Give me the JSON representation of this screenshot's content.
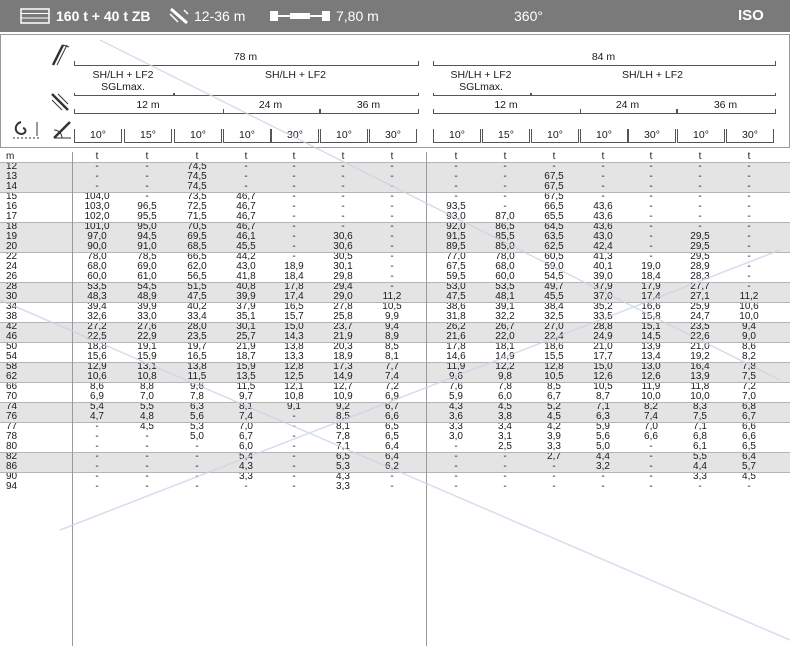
{
  "topbar": {
    "counterweight": "160 t + 40 t ZB",
    "superlift_radius": "12-36 m",
    "track_width": "7,80 m",
    "slewing": "360°",
    "standard": "ISO"
  },
  "header": {
    "main_boom": [
      {
        "label": "78 m"
      },
      {
        "label": "84 m"
      }
    ],
    "config": [
      {
        "line1": "SH/LH + LF2",
        "line2": "SGLmax."
      },
      {
        "line1": "SH/LH + LF2",
        "line2": ""
      },
      {
        "line1": "SH/LH + LF2",
        "line2": "SGLmax."
      },
      {
        "line1": "SH/LH + LF2",
        "line2": ""
      }
    ],
    "jib_lengths": [
      {
        "label": "12 m"
      },
      {
        "label": "24 m"
      },
      {
        "label": "36 m"
      },
      {
        "label": "12 m"
      },
      {
        "label": "24 m"
      },
      {
        "label": "36 m"
      }
    ],
    "angles": [
      "10°",
      "15°",
      "10°",
      "10°",
      "30°",
      "10°",
      "30°",
      "10°",
      "15°",
      "10°",
      "10°",
      "30°",
      "10°",
      "30°"
    ]
  },
  "table": {
    "unit_radius": "m",
    "unit_load": "t",
    "rows": [
      {
        "m": "12",
        "v": [
          "-",
          "-",
          "74,5",
          "-",
          "-",
          "-",
          "-",
          "-",
          "-",
          "-",
          "-",
          "-",
          "-",
          "-"
        ]
      },
      {
        "m": "13",
        "v": [
          "-",
          "-",
          "74,5",
          "-",
          "-",
          "-",
          "-",
          "-",
          "-",
          "67,5",
          "-",
          "-",
          "-",
          "-"
        ]
      },
      {
        "m": "14",
        "v": [
          "-",
          "-",
          "74,5",
          "-",
          "-",
          "-",
          "-",
          "-",
          "-",
          "67,5",
          "-",
          "-",
          "-",
          "-"
        ]
      },
      {
        "m": "15",
        "v": [
          "104,0",
          "-",
          "73,5",
          "46,7",
          "-",
          "-",
          "-",
          "-",
          "-",
          "67,5",
          "-",
          "-",
          "-",
          "-"
        ]
      },
      {
        "m": "16",
        "v": [
          "103,0",
          "96,5",
          "72,5",
          "46,7",
          "-",
          "-",
          "-",
          "93,5",
          "-",
          "66,5",
          "43,6",
          "-",
          "-",
          "-"
        ]
      },
      {
        "m": "17",
        "v": [
          "102,0",
          "95,5",
          "71,5",
          "46,7",
          "-",
          "-",
          "-",
          "93,0",
          "87,0",
          "65,5",
          "43,6",
          "-",
          "-",
          "-"
        ]
      },
      {
        "m": "18",
        "v": [
          "101,0",
          "95,0",
          "70,5",
          "46,7",
          "-",
          "-",
          "-",
          "92,0",
          "86,5",
          "64,5",
          "43,6",
          "-",
          "-",
          "-"
        ]
      },
      {
        "m": "19",
        "v": [
          "97,0",
          "94,5",
          "69,5",
          "46,1",
          "-",
          "30,6",
          "-",
          "91,5",
          "85,5",
          "63,5",
          "43,0",
          "-",
          "29,5",
          "-"
        ]
      },
      {
        "m": "20",
        "v": [
          "90,0",
          "91,0",
          "68,5",
          "45,5",
          "-",
          "30,6",
          "-",
          "89,5",
          "85,0",
          "62,5",
          "42,4",
          "-",
          "29,5",
          "-"
        ]
      },
      {
        "m": "22",
        "v": [
          "78,0",
          "78,5",
          "66,5",
          "44,2",
          "-",
          "30,5",
          "-",
          "77,0",
          "78,0",
          "60,5",
          "41,3",
          "-",
          "29,5",
          "-"
        ]
      },
      {
        "m": "24",
        "v": [
          "68,0",
          "69,0",
          "62,0",
          "43,0",
          "18,9",
          "30,1",
          "-",
          "67,5",
          "68,0",
          "59,0",
          "40,1",
          "19,0",
          "28,9",
          "-"
        ]
      },
      {
        "m": "26",
        "v": [
          "60,0",
          "61,0",
          "56,5",
          "41,8",
          "18,4",
          "29,8",
          "-",
          "59,5",
          "60,0",
          "54,5",
          "39,0",
          "18,4",
          "28,3",
          "-"
        ]
      },
      {
        "m": "28",
        "v": [
          "53,5",
          "54,5",
          "51,5",
          "40,8",
          "17,8",
          "29,4",
          "-",
          "53,0",
          "53,5",
          "49,7",
          "37,9",
          "17,9",
          "27,7",
          "-"
        ]
      },
      {
        "m": "30",
        "v": [
          "48,3",
          "48,9",
          "47,5",
          "39,9",
          "17,4",
          "29,0",
          "11,2",
          "47,5",
          "48,1",
          "45,5",
          "37,0",
          "17,4",
          "27,1",
          "11,2"
        ]
      },
      {
        "m": "34",
        "v": [
          "39,4",
          "39,9",
          "40,2",
          "37,9",
          "16,5",
          "27,8",
          "10,5",
          "38,6",
          "39,1",
          "38,4",
          "35,2",
          "16,6",
          "25,9",
          "10,6"
        ]
      },
      {
        "m": "38",
        "v": [
          "32,6",
          "33,0",
          "33,4",
          "35,1",
          "15,7",
          "25,8",
          "9,9",
          "31,8",
          "32,2",
          "32,5",
          "33,5",
          "15,8",
          "24,7",
          "10,0"
        ]
      },
      {
        "m": "42",
        "v": [
          "27,2",
          "27,6",
          "28,0",
          "30,1",
          "15,0",
          "23,7",
          "9,4",
          "26,2",
          "26,7",
          "27,0",
          "28,8",
          "15,1",
          "23,5",
          "9,4"
        ]
      },
      {
        "m": "46",
        "v": [
          "22,5",
          "22,9",
          "23,5",
          "25,7",
          "14,3",
          "21,9",
          "8,9",
          "21,6",
          "22,0",
          "22,4",
          "24,9",
          "14,5",
          "22,6",
          "9,0"
        ]
      },
      {
        "m": "50",
        "v": [
          "18,8",
          "19,1",
          "19,7",
          "21,9",
          "13,8",
          "20,3",
          "8,5",
          "17,8",
          "18,1",
          "18,6",
          "21,0",
          "13,9",
          "21,0",
          "8,6"
        ]
      },
      {
        "m": "54",
        "v": [
          "15,6",
          "15,9",
          "16,5",
          "18,7",
          "13,3",
          "18,9",
          "8,1",
          "14,6",
          "14,9",
          "15,5",
          "17,7",
          "13,4",
          "19,2",
          "8,2"
        ]
      },
      {
        "m": "58",
        "v": [
          "12,9",
          "13,1",
          "13,8",
          "15,9",
          "12,8",
          "17,3",
          "7,7",
          "11,9",
          "12,2",
          "12,8",
          "15,0",
          "13,0",
          "16,4",
          "7,8"
        ]
      },
      {
        "m": "62",
        "v": [
          "10,6",
          "10,8",
          "11,5",
          "13,5",
          "12,5",
          "14,9",
          "7,4",
          "9,6",
          "9,8",
          "10,5",
          "12,6",
          "12,6",
          "13,9",
          "7,5"
        ]
      },
      {
        "m": "66",
        "v": [
          "8,6",
          "8,8",
          "9,6",
          "11,5",
          "12,1",
          "12,7",
          "7,2",
          "7,6",
          "7,8",
          "8,5",
          "10,5",
          "11,9",
          "11,8",
          "7,2"
        ]
      },
      {
        "m": "70",
        "v": [
          "6,9",
          "7,0",
          "7,8",
          "9,7",
          "10,8",
          "10,9",
          "6,9",
          "5,9",
          "6,0",
          "6,7",
          "8,7",
          "10,0",
          "10,0",
          "7,0"
        ]
      },
      {
        "m": "74",
        "v": [
          "5,4",
          "5,5",
          "6,3",
          "8,1",
          "9,1",
          "9,2",
          "6,7",
          "4,3",
          "4,5",
          "5,2",
          "7,1",
          "8,2",
          "8,3",
          "6,8"
        ]
      },
      {
        "m": "76",
        "v": [
          "4,7",
          "4,8",
          "5,6",
          "7,4",
          "-",
          "8,5",
          "6,6",
          "3,6",
          "3,8",
          "4,5",
          "6,3",
          "7,4",
          "7,5",
          "6,7"
        ]
      },
      {
        "m": "77",
        "v": [
          "-",
          "4,5",
          "5,3",
          "7,0",
          "-",
          "8,1",
          "6,5",
          "3,3",
          "3,4",
          "4,2",
          "5,9",
          "7,0",
          "7,1",
          "6,6"
        ]
      },
      {
        "m": "78",
        "v": [
          "-",
          "-",
          "5,0",
          "6,7",
          "-",
          "7,8",
          "6,5",
          "3,0",
          "3,1",
          "3,9",
          "5,6",
          "6,6",
          "6,8",
          "6,6"
        ]
      },
      {
        "m": "80",
        "v": [
          "-",
          "-",
          "-",
          "6,0",
          "-",
          "7,1",
          "6,4",
          "-",
          "2,5",
          "3,3",
          "5,0",
          "-",
          "6,1",
          "6,5"
        ]
      },
      {
        "m": "82",
        "v": [
          "-",
          "-",
          "-",
          "5,4",
          "-",
          "6,5",
          "6,4",
          "-",
          "-",
          "2,7",
          "4,4",
          "-",
          "5,5",
          "6,4"
        ]
      },
      {
        "m": "86",
        "v": [
          "-",
          "-",
          "-",
          "4,3",
          "-",
          "5,3",
          "6,2",
          "-",
          "-",
          "-",
          "3,2",
          "-",
          "4,4",
          "5,7"
        ]
      },
      {
        "m": "90",
        "v": [
          "-",
          "-",
          "-",
          "3,3",
          "-",
          "4,3",
          "-",
          "-",
          "-",
          "-",
          "-",
          "-",
          "3,3",
          "4,5"
        ]
      },
      {
        "m": "94",
        "v": [
          "-",
          "-",
          "-",
          "-",
          "-",
          "3,3",
          "-",
          "-",
          "-",
          "-",
          "-",
          "-",
          "-",
          "-"
        ]
      }
    ]
  },
  "icons": {
    "counterweight": "counterweight-icon",
    "superlift": "superlift-radius-icon",
    "track": "crawler-track-icon",
    "main_boom": "main-boom-icon",
    "luffing_jib": "luffing-jib-icon",
    "jib_angle": "jib-angle-icon",
    "hook": "hook-radius-icon"
  }
}
